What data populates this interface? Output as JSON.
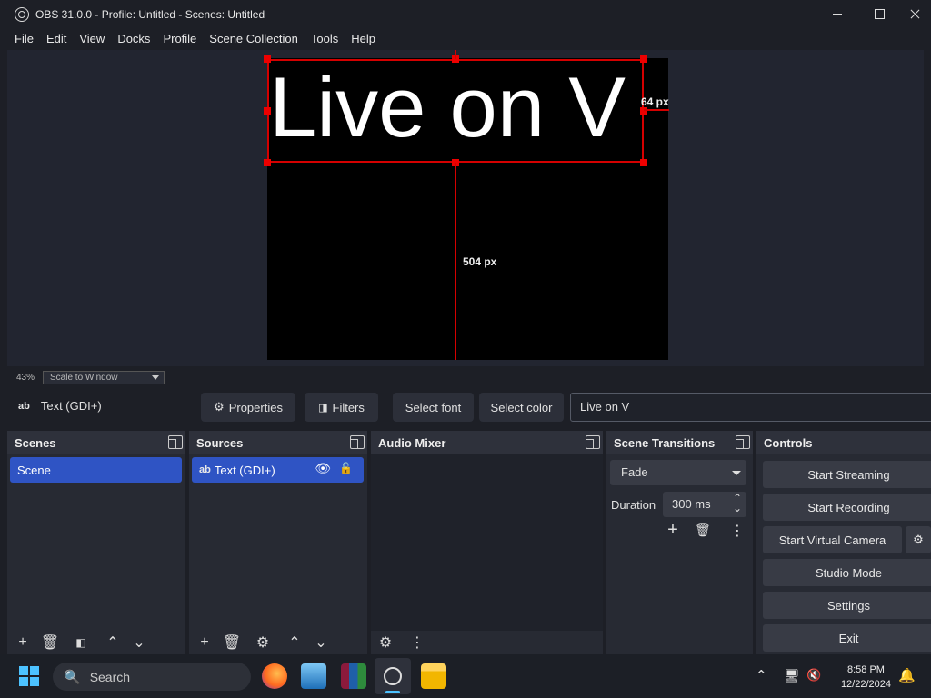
{
  "window": {
    "title": "OBS 31.0.0 - Profile: Untitled - Scenes: Untitled"
  },
  "menu": [
    "File",
    "Edit",
    "View",
    "Docks",
    "Profile",
    "Scene Collection",
    "Tools",
    "Help"
  ],
  "preview": {
    "text": "Live on V",
    "measure_right": "64 px",
    "measure_bottom": "504 px"
  },
  "zoom": {
    "percent": "43%",
    "mode": "Scale to Window"
  },
  "source_toolbar": {
    "source_type": "Text (GDI+)",
    "properties": "Properties",
    "filters": "Filters",
    "select_font": "Select font",
    "select_color": "Select color",
    "text_value": "Live on V"
  },
  "scenes": {
    "title": "Scenes",
    "items": [
      "Scene"
    ]
  },
  "sources": {
    "title": "Sources",
    "items": [
      "Text (GDI+)"
    ]
  },
  "audio_mixer": {
    "title": "Audio Mixer"
  },
  "transitions": {
    "title": "Scene Transitions",
    "selected": "Fade",
    "duration_label": "Duration",
    "duration_value": "300 ms"
  },
  "controls": {
    "title": "Controls",
    "start_streaming": "Start Streaming",
    "start_recording": "Start Recording",
    "start_virtual_camera": "Start Virtual Camera",
    "studio_mode": "Studio Mode",
    "settings": "Settings",
    "exit": "Exit"
  },
  "taskbar": {
    "search_placeholder": "Search",
    "time": "8:58 PM",
    "date": "12/22/2024"
  },
  "colors": {
    "accent": "#2f54c4",
    "guide": "#d40000",
    "background": "#1d1f26",
    "panel": "#272a33"
  }
}
